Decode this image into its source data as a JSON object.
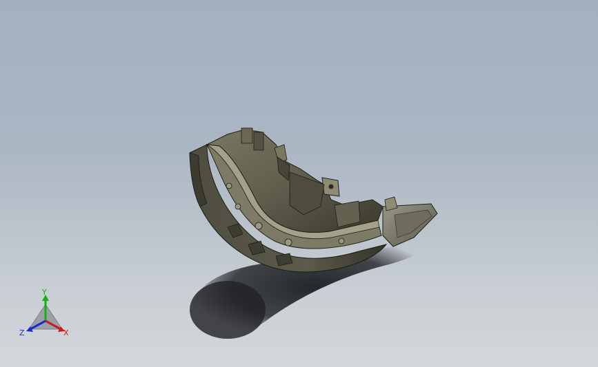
{
  "viewport": {
    "background_top": "#a2b0c0",
    "background_bottom": "#d4d7da"
  },
  "model": {
    "part_color": "#5f5d4c",
    "part_highlight": "#8d8b74",
    "part_dark": "#2a2a22",
    "shadow_color": "#1f2124"
  },
  "triad": {
    "x_label": "X",
    "y_label": "Y",
    "z_label": "Z",
    "x_color": "#d01a1a",
    "y_color": "#18b018",
    "z_color": "#1a2ad0"
  }
}
